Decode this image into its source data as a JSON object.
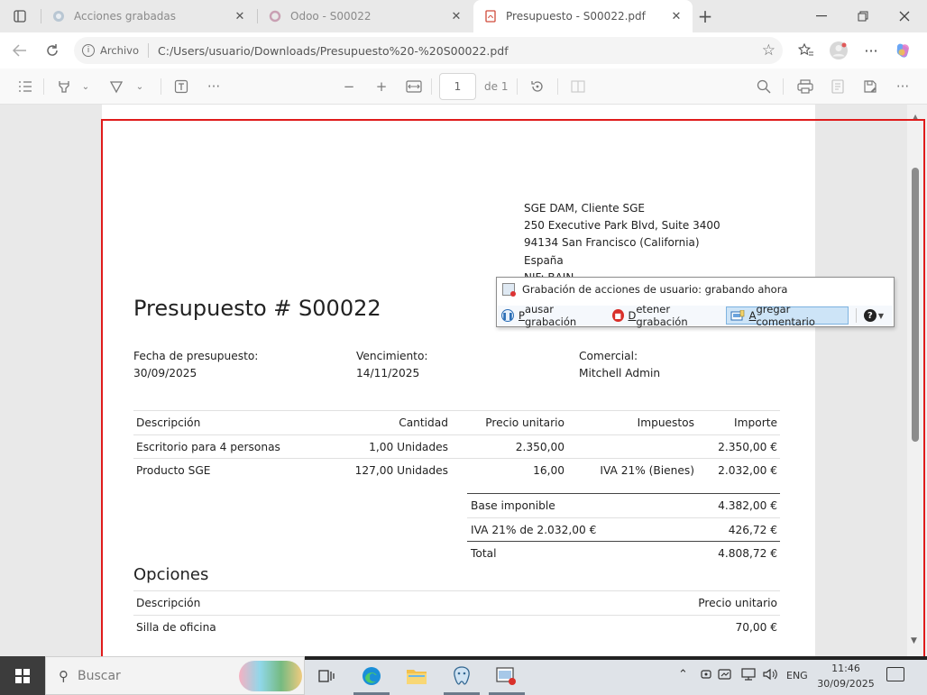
{
  "browser": {
    "tabs": [
      {
        "label": "Acciones grabadas",
        "icon": "edge-page-icon",
        "active": false
      },
      {
        "label": "Odoo - S00022",
        "icon": "odoo-icon",
        "active": false
      },
      {
        "label": "Presupuesto - S00022.pdf",
        "icon": "pdf-icon",
        "active": true
      }
    ],
    "new_tab": "+",
    "address": {
      "scheme": "Archivo",
      "url": "C:/Users/usuario/Downloads/Presupuesto%20-%20S00022.pdf"
    }
  },
  "pdf_toolbar": {
    "page_current": "1",
    "page_of": "de 1"
  },
  "document": {
    "address_lines": [
      "SGE DAM, Cliente SGE",
      "250 Executive Park Blvd, Suite 3400",
      "94134 San Francisco (California)",
      "España",
      "NIF: BAIN"
    ],
    "title": "Presupuesto # S00022",
    "info": [
      {
        "label": "Fecha de presupuesto:",
        "value": "30/09/2025"
      },
      {
        "label": "Vencimiento:",
        "value": "14/11/2025"
      },
      {
        "label": "Comercial:",
        "value": "Mitchell Admin"
      }
    ],
    "lines_table": {
      "headers": [
        "Descripción",
        "Cantidad",
        "Precio unitario",
        "Impuestos",
        "Importe"
      ],
      "rows": [
        [
          "Escritorio para 4 personas",
          "1,00 Unidades",
          "2.350,00",
          "",
          "2.350,00 €"
        ],
        [
          "Producto SGE",
          "127,00 Unidades",
          "16,00",
          "IVA 21% (Bienes)",
          "2.032,00 €"
        ]
      ]
    },
    "totals": [
      {
        "label": "Base imponible",
        "value": "4.382,00 €"
      },
      {
        "label": "IVA 21% de 2.032,00 €",
        "value": "426,72 €"
      },
      {
        "label": "Total",
        "value": "4.808,72 €"
      }
    ],
    "options": {
      "title": "Opciones",
      "headers": [
        "Descripción",
        "Precio unitario"
      ],
      "rows": [
        [
          "Silla de oficina",
          "70,00 €"
        ]
      ]
    }
  },
  "recorder": {
    "status": "Grabación de acciones de usuario: grabando ahora",
    "pause": {
      "underline": "P",
      "rest": "ausar grabación"
    },
    "stop": {
      "underline": "D",
      "rest": "etener grabación"
    },
    "comment": {
      "underline": "A",
      "rest": "gregar comentario"
    }
  },
  "taskbar": {
    "search_placeholder": "Buscar",
    "language": "ENG",
    "time": "11:46",
    "date": "30/09/2025"
  }
}
